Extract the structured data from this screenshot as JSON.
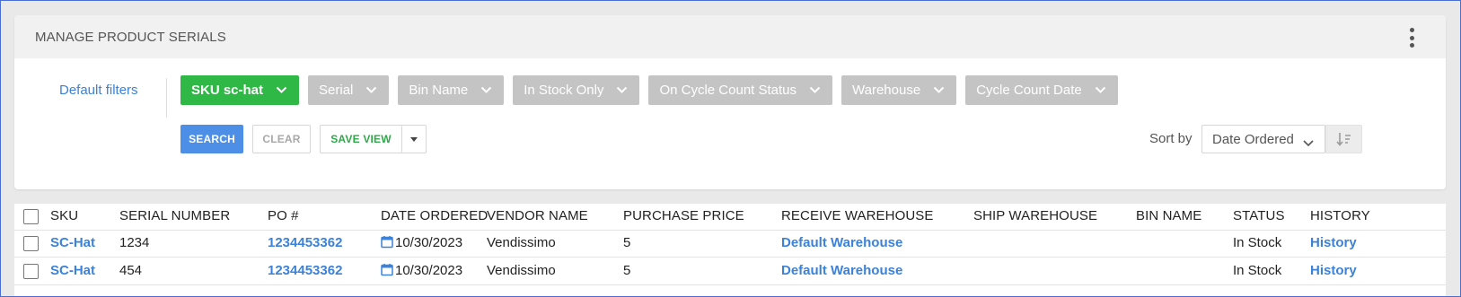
{
  "panel": {
    "title": "MANAGE PRODUCT SERIALS",
    "default_filters": "Default filters"
  },
  "filters": [
    {
      "label": "SKU sc-hat",
      "active": true
    },
    {
      "label": "Serial",
      "active": false
    },
    {
      "label": "Bin Name",
      "active": false
    },
    {
      "label": "In Stock Only",
      "active": false
    },
    {
      "label": "On Cycle Count Status",
      "active": false
    },
    {
      "label": "Warehouse",
      "active": false
    },
    {
      "label": "Cycle Count Date",
      "active": false
    }
  ],
  "actions": {
    "search": "SEARCH",
    "clear": "CLEAR",
    "save_view": "SAVE VIEW"
  },
  "sort": {
    "label": "Sort by",
    "value": "Date Ordered"
  },
  "table": {
    "columns": [
      "SKU",
      "SERIAL NUMBER",
      "PO #",
      "DATE ORDERED",
      "VENDOR NAME",
      "PURCHASE PRICE",
      "RECEIVE WAREHOUSE",
      "SHIP WAREHOUSE",
      "BIN NAME",
      "STATUS",
      "HISTORY"
    ],
    "rows": [
      {
        "sku": "SC-Hat",
        "serial": "1234",
        "po": "1234453362",
        "date": "10/30/2023",
        "vendor": "Vendissimo",
        "price": "5",
        "receive_wh": "Default Warehouse",
        "ship_wh": "",
        "bin": "",
        "status": "In Stock",
        "history": "History"
      },
      {
        "sku": "SC-Hat",
        "serial": "454",
        "po": "1234453362",
        "date": "10/30/2023",
        "vendor": "Vendissimo",
        "price": "5",
        "receive_wh": "Default Warehouse",
        "ship_wh": "",
        "bin": "",
        "status": "In Stock",
        "history": "History"
      }
    ]
  },
  "colors": {
    "accent_blue": "#3b82d8",
    "active_chip": "#2fb846",
    "inactive_chip": "#c4c4c4",
    "search_button": "#4d8fe6"
  }
}
